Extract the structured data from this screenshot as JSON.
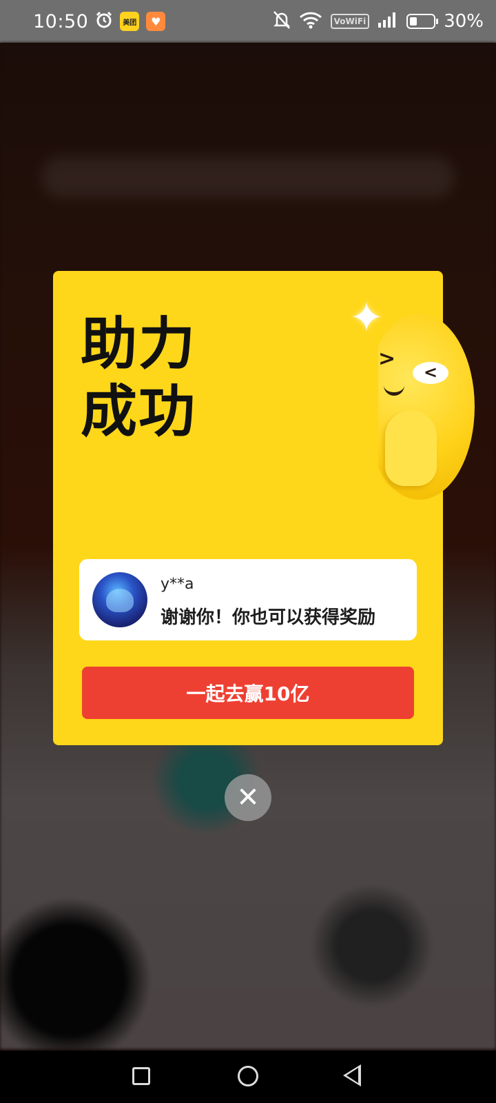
{
  "status_bar": {
    "time": "10:50",
    "left_icons": [
      "alarm-icon",
      "meituan-app-icon",
      "heart-app-icon"
    ],
    "meituan_label": "美团",
    "right_icons": [
      "bell-off-icon",
      "wifi-icon",
      "vowifi-icon",
      "signal-icon",
      "battery-icon"
    ],
    "vowifi_label": "VoWiFi",
    "battery_percent": "30%"
  },
  "dialog": {
    "title": "助力\n成功",
    "user": {
      "name": "y**a",
      "message": "谢谢你！你也可以获得奖励"
    },
    "cta_label": "一起去赢10亿",
    "close_glyph": "✕"
  },
  "nav_bar": {
    "items": [
      "recent-apps",
      "home",
      "back"
    ]
  },
  "colors": {
    "dialog_bg": "#ffd71a",
    "cta_bg": "#ee4032",
    "status_bar_bg": "#6f6f6f"
  }
}
